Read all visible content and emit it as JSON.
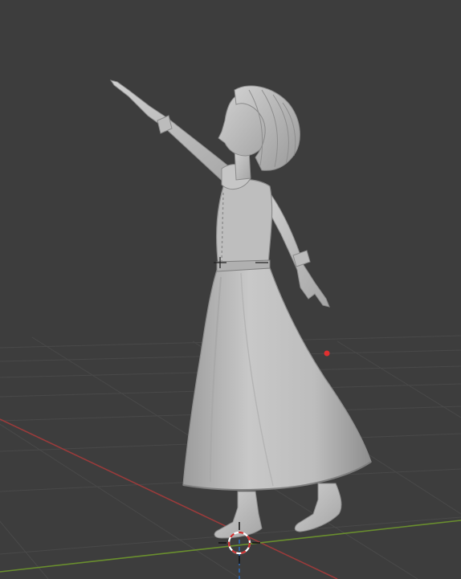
{
  "app": "Blender",
  "viewport": {
    "background": "#3d3d3d",
    "grid_color": "#4a4a4a",
    "x_axis_color": "#9a3b3b",
    "y_axis_color": "#6a8f2e",
    "z_axis_color": "#2f6fc4",
    "model_color": "#c4c4c4",
    "selected_object": "character-mesh",
    "icons": {
      "cursor": "3d-cursor-icon",
      "origin": "object-origin-icon",
      "light": "light-point-icon"
    }
  }
}
